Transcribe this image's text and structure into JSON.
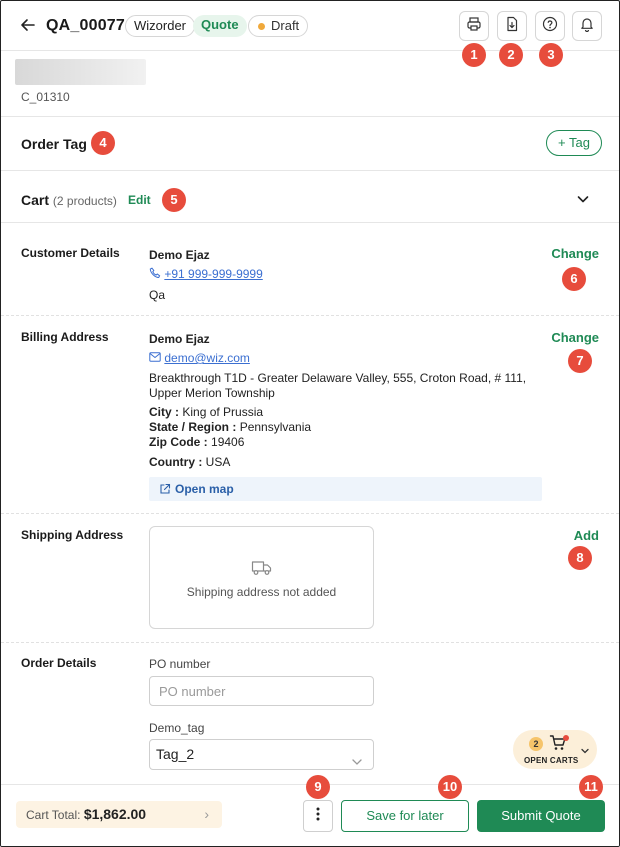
{
  "header": {
    "title": "QA_00077",
    "chip_type": "Wizorder",
    "chip_status": "Quote",
    "chip_state": "Draft",
    "icons": [
      "printer-icon",
      "download-file-icon",
      "help-icon",
      "bell-icon"
    ]
  },
  "badges": [
    "1",
    "2",
    "3",
    "4",
    "5",
    "6",
    "7",
    "8",
    "9",
    "10",
    "11"
  ],
  "customer": {
    "code": "C_01310"
  },
  "order_tag": {
    "title": "Order Tag",
    "add_label": "Tag"
  },
  "cart": {
    "title": "Cart",
    "count": "(2 products)",
    "edit_label": "Edit"
  },
  "customer_details": {
    "label": "Customer Details",
    "name": "Demo Ejaz",
    "phone": "+91 999-999-9999",
    "note": "Qa",
    "action": "Change"
  },
  "billing": {
    "label": "Billing Address",
    "name": "Demo Ejaz",
    "email": "demo@wiz.com",
    "address_line1": "Breakthrough T1D - Greater Delaware Valley, 555, Croton Road, # 111,",
    "address_line2": "Upper Merion Township",
    "city_label": "City :",
    "city": "King of Prussia",
    "state_label": "State / Region :",
    "state": "Pennsylvania",
    "zip_label": "Zip Code :",
    "zip": "19406",
    "country_label": "Country :",
    "country": "USA",
    "open_map": "Open map",
    "action": "Change"
  },
  "shipping": {
    "label": "Shipping Address",
    "empty_text": "Shipping address not added",
    "action": "Add"
  },
  "order_details": {
    "label": "Order Details",
    "po_label": "PO number",
    "po_placeholder": "PO number",
    "tag_label": "Demo_tag",
    "tag_value": "Tag_2"
  },
  "open_carts": {
    "count": "2",
    "label": "OPEN CARTS"
  },
  "footer": {
    "cart_total_label": "Cart Total:",
    "cart_total_value": "$1,862.00",
    "save_label": "Save for later",
    "submit_label": "Submit Quote"
  },
  "colors": {
    "accent": "#1f8a55",
    "badge": "#e74c3c",
    "link": "#3b6fd1"
  }
}
